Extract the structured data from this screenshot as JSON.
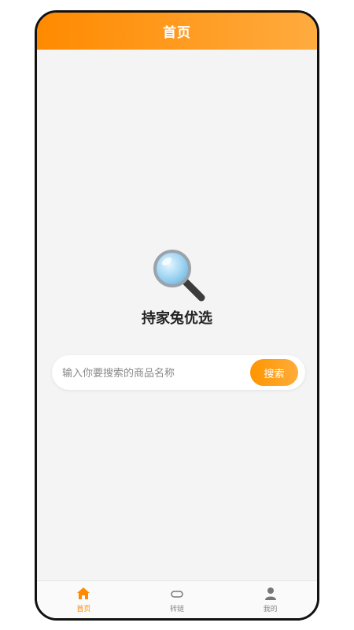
{
  "header": {
    "title": "首页"
  },
  "brand": {
    "name": "持家兔优选",
    "icon": "magnifying-glass-icon"
  },
  "search": {
    "placeholder": "输入你要搜索的商品名称",
    "value": "",
    "button_label": "搜索"
  },
  "tabbar": {
    "items": [
      {
        "label": "首页",
        "icon": "home-icon",
        "active": true
      },
      {
        "label": "转链",
        "icon": "link-icon",
        "active": false
      },
      {
        "label": "我的",
        "icon": "user-icon",
        "active": false
      }
    ]
  },
  "colors": {
    "accent": "#ff8a00",
    "accent_light": "#ffab3f",
    "background": "#f4f4f4",
    "text_dark": "#222222",
    "text_muted": "#8a8a8a"
  }
}
